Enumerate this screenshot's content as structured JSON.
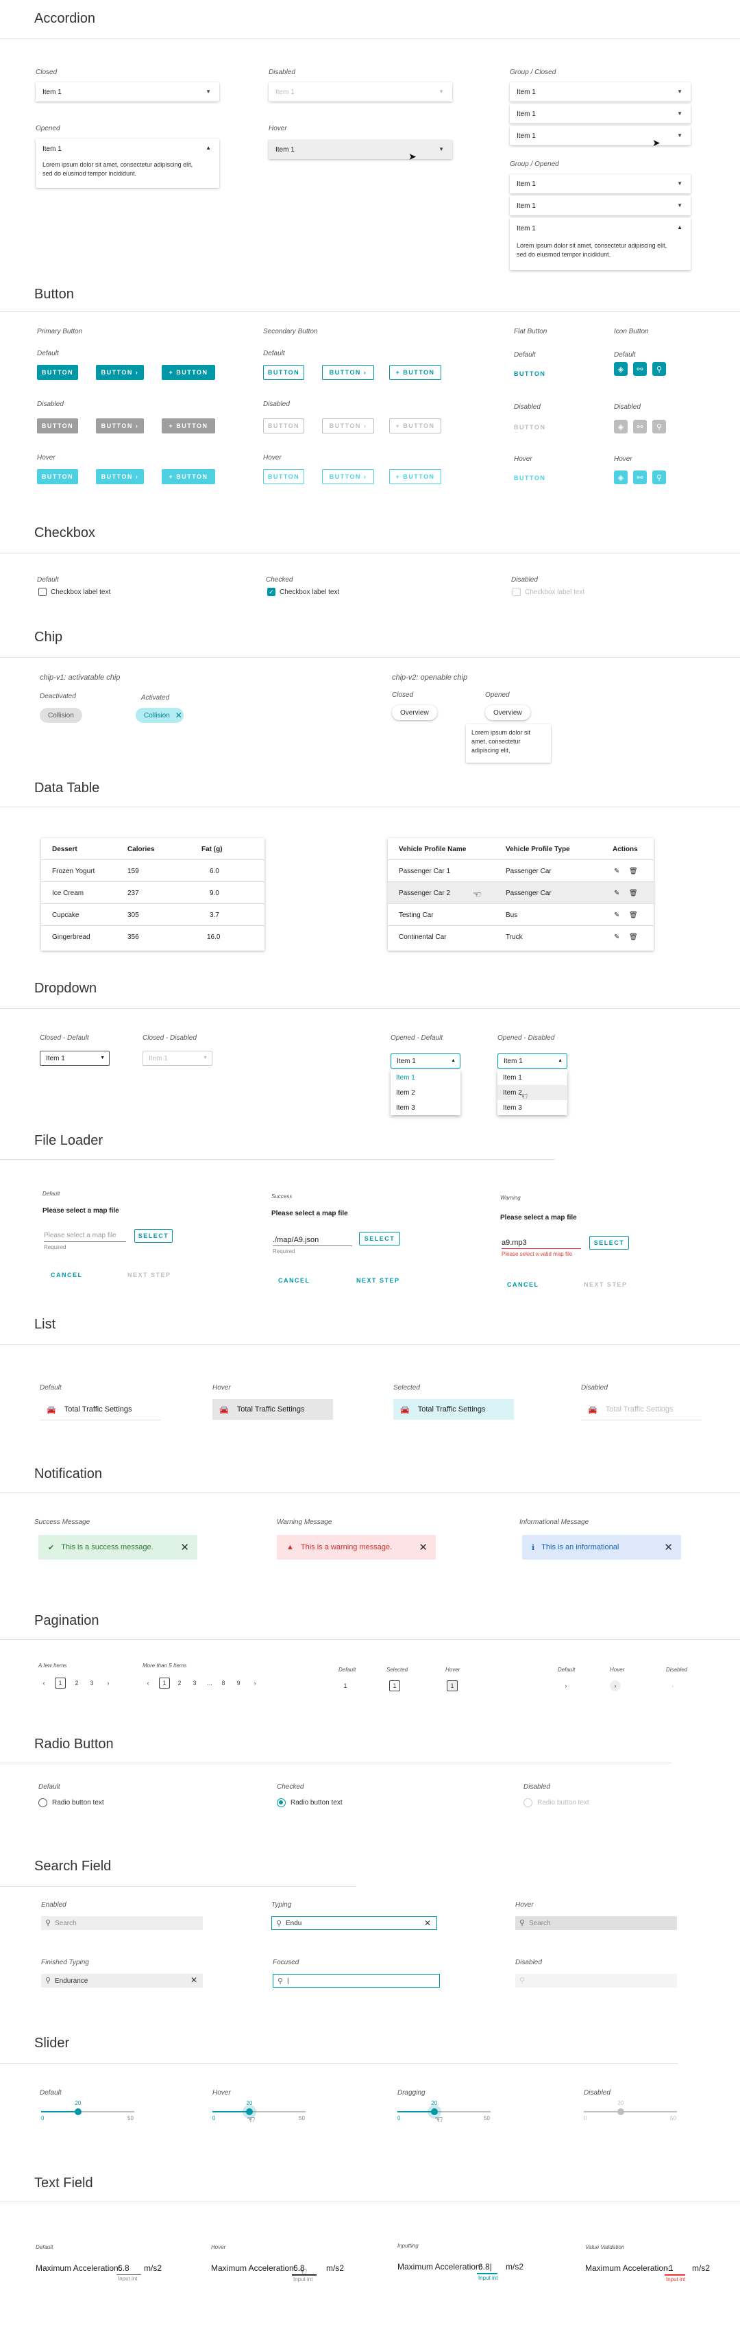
{
  "accordion": {
    "title": "Accordion",
    "captions": {
      "closed": "Closed",
      "disabled": "Disabled",
      "group_closed": "Group / Closed",
      "opened": "Opened",
      "hover": "Hover",
      "group_opened": "Group / Opened"
    },
    "item": "Item 1",
    "body": "Lorem ipsum dolor sit amet, consectetur adipiscing elit, sed do eiusmod tempor incididunt."
  },
  "button": {
    "title": "Button",
    "captions": {
      "primary": "Primary Button",
      "secondary": "Secondary Button",
      "flat": "Flat Button",
      "icon": "Icon Button",
      "default": "Default",
      "disabled": "Disabled",
      "hover": "Hover"
    },
    "label": "BUTTON",
    "label_next": "BUTTON  ›",
    "label_add": "+  BUTTON"
  },
  "checkbox": {
    "title": "Checkbox",
    "captions": {
      "default": "Default",
      "checked": "Checked",
      "disabled": "Disabled"
    },
    "label": "Checkbox label text"
  },
  "chip": {
    "title": "Chip",
    "captions": {
      "v1": "chip-v1: activatable chip",
      "v2": "chip-v2: openable chip",
      "deactivated": "Deactivated",
      "activated": "Activated",
      "closed": "Closed",
      "opened": "Opened"
    },
    "collision": "Collision",
    "overview": "Overview",
    "popup": "Lorem ipsum dolor sit amet, consectetur adipiscing elit,"
  },
  "data_table": {
    "title": "Data Table",
    "t1_headers": [
      "Dessert",
      "Calories",
      "Fat (g)"
    ],
    "t1_rows": [
      [
        "Frozen Yogurt",
        "159",
        "6.0"
      ],
      [
        "Ice Cream",
        "237",
        "9.0"
      ],
      [
        "Cupcake",
        "305",
        "3.7"
      ],
      [
        "Gingerbread",
        "356",
        "16.0"
      ]
    ],
    "t2_headers": [
      "Vehicle Profile Name",
      "Vehicle Profile Type",
      "Actions"
    ],
    "t2_rows": [
      [
        "Passenger Car 1",
        "Passenger Car"
      ],
      [
        "Passenger Car 2",
        "Passenger Car"
      ],
      [
        "Testing Car",
        "Bus"
      ],
      [
        "Continental Car",
        "Truck"
      ]
    ]
  },
  "dropdown": {
    "title": "Dropdown",
    "captions": {
      "cd": "Closed - Default",
      "cdis": "Closed - Disabled",
      "od": "Opened - Default",
      "odis": "Opened - Disabled"
    },
    "item1": "Item 1",
    "item2": "Item 2",
    "item3": "Item 3"
  },
  "file_loader": {
    "title": "File Loader",
    "captions": {
      "default": "Default",
      "success": "Success",
      "warning": "Warning"
    },
    "heading": "Please select a map file",
    "placeholder": "Please select a map file",
    "required": "Required",
    "success_value": "./map/A9.json",
    "warning_value": "a9.mp3",
    "warning_msg": "Please select a valid map file",
    "select": "SELECT",
    "cancel": "CANCEL",
    "next": "NEXT STEP"
  },
  "list": {
    "title": "List",
    "captions": {
      "default": "Default",
      "hover": "Hover",
      "selected": "Selected",
      "disabled": "Disabled"
    },
    "item": "Total Traffic Settings"
  },
  "notification": {
    "title": "Notification",
    "captions": {
      "success": "Success Message",
      "warning": "Warning Message",
      "info": "Informational Message"
    },
    "success": "This is a success message.",
    "warning": "This is a warning message.",
    "info": "This is an informational"
  },
  "pagination": {
    "title": "Pagination",
    "captions": {
      "few": "A few Items",
      "many": "More than 5 Items",
      "default": "Default",
      "selected": "Selected",
      "hover": "Hover"
    },
    "p1": "1",
    "p2": "2",
    "p3": "3",
    "p8": "8",
    "p9": "9",
    "dots": "..."
  },
  "radio": {
    "title": "Radio Button",
    "captions": {
      "default": "Default",
      "checked": "Checked",
      "disabled": "Disabled"
    },
    "label": "Radio button text"
  },
  "search": {
    "title": "Search Field",
    "captions": {
      "enabled": "Enabled",
      "typing": "Typing",
      "hover": "Hover",
      "finished": "Finished Typing",
      "focused": "Focused",
      "disabled": "Disabled"
    },
    "placeholder": "Search",
    "typing": "Endu",
    "finished": "Endurance",
    "focused": "|"
  },
  "slider": {
    "title": "Slider",
    "captions": {
      "default": "Default",
      "hover": "Hover",
      "dragging": "Dragging",
      "disabled": "Disabled"
    },
    "value": "20",
    "min": "0",
    "max": "50",
    "level": 0.4
  },
  "text_field": {
    "title": "Text Field",
    "captions": {
      "default": "Default",
      "hover": "Hover",
      "inputting": "Inputting",
      "validation": "Value Validation"
    },
    "label": "Maximum Acceleration:",
    "value": "6.8",
    "neg": "-1",
    "unit": "m/s2",
    "hint": "Input int"
  }
}
